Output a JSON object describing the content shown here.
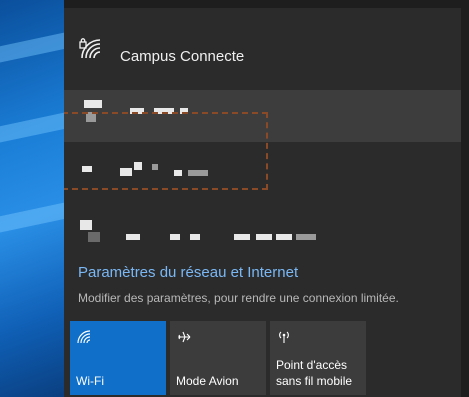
{
  "network": {
    "name": "Campus Connecte",
    "icon": "wifi-secured-icon"
  },
  "settings": {
    "link": "Paramètres du réseau et Internet",
    "description": "Modifier des paramètres, pour rendre une connexion limitée."
  },
  "tiles": [
    {
      "label": "Wi-Fi",
      "icon": "wifi-icon",
      "active": true
    },
    {
      "label": "Mode Avion",
      "icon": "airplane-icon",
      "active": false
    },
    {
      "label": "Point d'accès sans fil mobile",
      "line1": "Point d'accès",
      "line2": "sans fil mobile",
      "icon": "hotspot-icon",
      "active": false
    }
  ],
  "colors": {
    "accent": "#0f6fc9",
    "link": "#7ab8f5",
    "panel_bg": "#2b2b2b",
    "annotation_border": "#8a4a28"
  }
}
